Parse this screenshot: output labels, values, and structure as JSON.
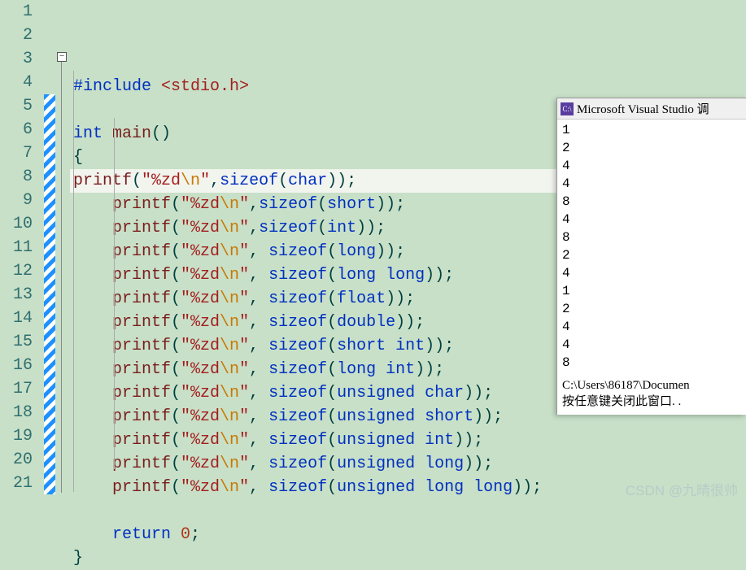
{
  "code": {
    "lines": [
      {
        "n": 1,
        "segs": [
          {
            "t": "#include ",
            "c": "kw"
          },
          {
            "t": "<stdio.h>",
            "c": "ang"
          }
        ],
        "indent": 0
      },
      {
        "n": 2,
        "segs": [],
        "indent": 0
      },
      {
        "n": 3,
        "segs": [
          {
            "t": "int",
            "c": "ty"
          },
          {
            "t": " "
          },
          {
            "t": "main",
            "c": "fn"
          },
          {
            "t": "()",
            "c": "pun"
          }
        ],
        "indent": 0
      },
      {
        "n": 4,
        "segs": [
          {
            "t": "{",
            "c": "pun"
          }
        ],
        "indent": 0
      },
      {
        "n": 5,
        "hl": true,
        "segs": [
          {
            "t": "printf",
            "c": "lib"
          },
          {
            "t": "(",
            "c": "pun"
          },
          {
            "t": "\"%zd",
            "c": "str"
          },
          {
            "t": "\\n",
            "c": "esc"
          },
          {
            "t": "\"",
            "c": "str"
          },
          {
            "t": ",",
            "c": "pun"
          },
          {
            "t": "sizeof",
            "c": "kw"
          },
          {
            "t": "(",
            "c": "pun"
          },
          {
            "t": "char",
            "c": "ty"
          },
          {
            "t": "));",
            "c": "pun"
          }
        ],
        "indent": 0
      },
      {
        "n": 6,
        "segs": [
          {
            "t": "printf",
            "c": "lib"
          },
          {
            "t": "(",
            "c": "pun"
          },
          {
            "t": "\"%zd",
            "c": "str"
          },
          {
            "t": "\\n",
            "c": "esc"
          },
          {
            "t": "\"",
            "c": "str"
          },
          {
            "t": ",",
            "c": "pun"
          },
          {
            "t": "sizeof",
            "c": "kw"
          },
          {
            "t": "(",
            "c": "pun"
          },
          {
            "t": "short",
            "c": "ty"
          },
          {
            "t": "));",
            "c": "pun"
          }
        ],
        "indent": 1
      },
      {
        "n": 7,
        "segs": [
          {
            "t": "printf",
            "c": "lib"
          },
          {
            "t": "(",
            "c": "pun"
          },
          {
            "t": "\"%zd",
            "c": "str"
          },
          {
            "t": "\\n",
            "c": "esc"
          },
          {
            "t": "\"",
            "c": "str"
          },
          {
            "t": ",",
            "c": "pun"
          },
          {
            "t": "sizeof",
            "c": "kw"
          },
          {
            "t": "(",
            "c": "pun"
          },
          {
            "t": "int",
            "c": "ty"
          },
          {
            "t": "));",
            "c": "pun"
          }
        ],
        "indent": 1
      },
      {
        "n": 8,
        "segs": [
          {
            "t": "printf",
            "c": "lib"
          },
          {
            "t": "(",
            "c": "pun"
          },
          {
            "t": "\"%zd",
            "c": "str"
          },
          {
            "t": "\\n",
            "c": "esc"
          },
          {
            "t": "\"",
            "c": "str"
          },
          {
            "t": ", ",
            "c": "pun"
          },
          {
            "t": "sizeof",
            "c": "kw"
          },
          {
            "t": "(",
            "c": "pun"
          },
          {
            "t": "long",
            "c": "ty"
          },
          {
            "t": "));",
            "c": "pun"
          }
        ],
        "indent": 1
      },
      {
        "n": 9,
        "segs": [
          {
            "t": "printf",
            "c": "lib"
          },
          {
            "t": "(",
            "c": "pun"
          },
          {
            "t": "\"%zd",
            "c": "str"
          },
          {
            "t": "\\n",
            "c": "esc"
          },
          {
            "t": "\"",
            "c": "str"
          },
          {
            "t": ", ",
            "c": "pun"
          },
          {
            "t": "sizeof",
            "c": "kw"
          },
          {
            "t": "(",
            "c": "pun"
          },
          {
            "t": "long long",
            "c": "ty"
          },
          {
            "t": "));",
            "c": "pun"
          }
        ],
        "indent": 1
      },
      {
        "n": 10,
        "segs": [
          {
            "t": "printf",
            "c": "lib"
          },
          {
            "t": "(",
            "c": "pun"
          },
          {
            "t": "\"%zd",
            "c": "str"
          },
          {
            "t": "\\n",
            "c": "esc"
          },
          {
            "t": "\"",
            "c": "str"
          },
          {
            "t": ", ",
            "c": "pun"
          },
          {
            "t": "sizeof",
            "c": "kw"
          },
          {
            "t": "(",
            "c": "pun"
          },
          {
            "t": "float",
            "c": "ty"
          },
          {
            "t": "));",
            "c": "pun"
          }
        ],
        "indent": 1
      },
      {
        "n": 11,
        "segs": [
          {
            "t": "printf",
            "c": "lib"
          },
          {
            "t": "(",
            "c": "pun"
          },
          {
            "t": "\"%zd",
            "c": "str"
          },
          {
            "t": "\\n",
            "c": "esc"
          },
          {
            "t": "\"",
            "c": "str"
          },
          {
            "t": ", ",
            "c": "pun"
          },
          {
            "t": "sizeof",
            "c": "kw"
          },
          {
            "t": "(",
            "c": "pun"
          },
          {
            "t": "double",
            "c": "ty"
          },
          {
            "t": "));",
            "c": "pun"
          }
        ],
        "indent": 1
      },
      {
        "n": 12,
        "segs": [
          {
            "t": "printf",
            "c": "lib"
          },
          {
            "t": "(",
            "c": "pun"
          },
          {
            "t": "\"%zd",
            "c": "str"
          },
          {
            "t": "\\n",
            "c": "esc"
          },
          {
            "t": "\"",
            "c": "str"
          },
          {
            "t": ", ",
            "c": "pun"
          },
          {
            "t": "sizeof",
            "c": "kw"
          },
          {
            "t": "(",
            "c": "pun"
          },
          {
            "t": "short int",
            "c": "ty"
          },
          {
            "t": "));",
            "c": "pun"
          }
        ],
        "indent": 1
      },
      {
        "n": 13,
        "segs": [
          {
            "t": "printf",
            "c": "lib"
          },
          {
            "t": "(",
            "c": "pun"
          },
          {
            "t": "\"%zd",
            "c": "str"
          },
          {
            "t": "\\n",
            "c": "esc"
          },
          {
            "t": "\"",
            "c": "str"
          },
          {
            "t": ", ",
            "c": "pun"
          },
          {
            "t": "sizeof",
            "c": "kw"
          },
          {
            "t": "(",
            "c": "pun"
          },
          {
            "t": "long int",
            "c": "ty"
          },
          {
            "t": "));",
            "c": "pun"
          }
        ],
        "indent": 1
      },
      {
        "n": 14,
        "segs": [
          {
            "t": "printf",
            "c": "lib"
          },
          {
            "t": "(",
            "c": "pun"
          },
          {
            "t": "\"%zd",
            "c": "str"
          },
          {
            "t": "\\n",
            "c": "esc"
          },
          {
            "t": "\"",
            "c": "str"
          },
          {
            "t": ", ",
            "c": "pun"
          },
          {
            "t": "sizeof",
            "c": "kw"
          },
          {
            "t": "(",
            "c": "pun"
          },
          {
            "t": "unsigned char",
            "c": "ty"
          },
          {
            "t": "));",
            "c": "pun"
          }
        ],
        "indent": 1
      },
      {
        "n": 15,
        "segs": [
          {
            "t": "printf",
            "c": "lib"
          },
          {
            "t": "(",
            "c": "pun"
          },
          {
            "t": "\"%zd",
            "c": "str"
          },
          {
            "t": "\\n",
            "c": "esc"
          },
          {
            "t": "\"",
            "c": "str"
          },
          {
            "t": ", ",
            "c": "pun"
          },
          {
            "t": "sizeof",
            "c": "kw"
          },
          {
            "t": "(",
            "c": "pun"
          },
          {
            "t": "unsigned short",
            "c": "ty"
          },
          {
            "t": "));",
            "c": "pun"
          }
        ],
        "indent": 1
      },
      {
        "n": 16,
        "segs": [
          {
            "t": "printf",
            "c": "lib"
          },
          {
            "t": "(",
            "c": "pun"
          },
          {
            "t": "\"%zd",
            "c": "str"
          },
          {
            "t": "\\n",
            "c": "esc"
          },
          {
            "t": "\"",
            "c": "str"
          },
          {
            "t": ", ",
            "c": "pun"
          },
          {
            "t": "sizeof",
            "c": "kw"
          },
          {
            "t": "(",
            "c": "pun"
          },
          {
            "t": "unsigned int",
            "c": "ty"
          },
          {
            "t": "));",
            "c": "pun"
          }
        ],
        "indent": 1
      },
      {
        "n": 17,
        "segs": [
          {
            "t": "printf",
            "c": "lib"
          },
          {
            "t": "(",
            "c": "pun"
          },
          {
            "t": "\"%zd",
            "c": "str"
          },
          {
            "t": "\\n",
            "c": "esc"
          },
          {
            "t": "\"",
            "c": "str"
          },
          {
            "t": ", ",
            "c": "pun"
          },
          {
            "t": "sizeof",
            "c": "kw"
          },
          {
            "t": "(",
            "c": "pun"
          },
          {
            "t": "unsigned long",
            "c": "ty"
          },
          {
            "t": "));",
            "c": "pun"
          }
        ],
        "indent": 1
      },
      {
        "n": 18,
        "segs": [
          {
            "t": "printf",
            "c": "lib"
          },
          {
            "t": "(",
            "c": "pun"
          },
          {
            "t": "\"%zd",
            "c": "str"
          },
          {
            "t": "\\n",
            "c": "esc"
          },
          {
            "t": "\"",
            "c": "str"
          },
          {
            "t": ", ",
            "c": "pun"
          },
          {
            "t": "sizeof",
            "c": "kw"
          },
          {
            "t": "(",
            "c": "pun"
          },
          {
            "t": "unsigned long long",
            "c": "ty"
          },
          {
            "t": "));",
            "c": "pun"
          }
        ],
        "indent": 1
      },
      {
        "n": 19,
        "segs": [],
        "indent": 1
      },
      {
        "n": 20,
        "segs": [
          {
            "t": "return ",
            "c": "kw"
          },
          {
            "t": "0",
            "c": "num"
          },
          {
            "t": ";",
            "c": "pun"
          }
        ],
        "indent": 1
      },
      {
        "n": 21,
        "segs": [
          {
            "t": "}",
            "c": "pun"
          }
        ],
        "indent": 0
      }
    ]
  },
  "output": {
    "title": "Microsoft Visual Studio 调",
    "icon_label": "C:\\",
    "values": [
      "1",
      "2",
      "4",
      "4",
      "8",
      "4",
      "8",
      "2",
      "4",
      "1",
      "2",
      "4",
      "4",
      "8"
    ],
    "footer_path": "C:\\Users\\86187\\Documen",
    "footer_prompt": "按任意键关闭此窗口. ."
  },
  "fold_marker": "−",
  "watermark": "CSDN @九晴很帅"
}
